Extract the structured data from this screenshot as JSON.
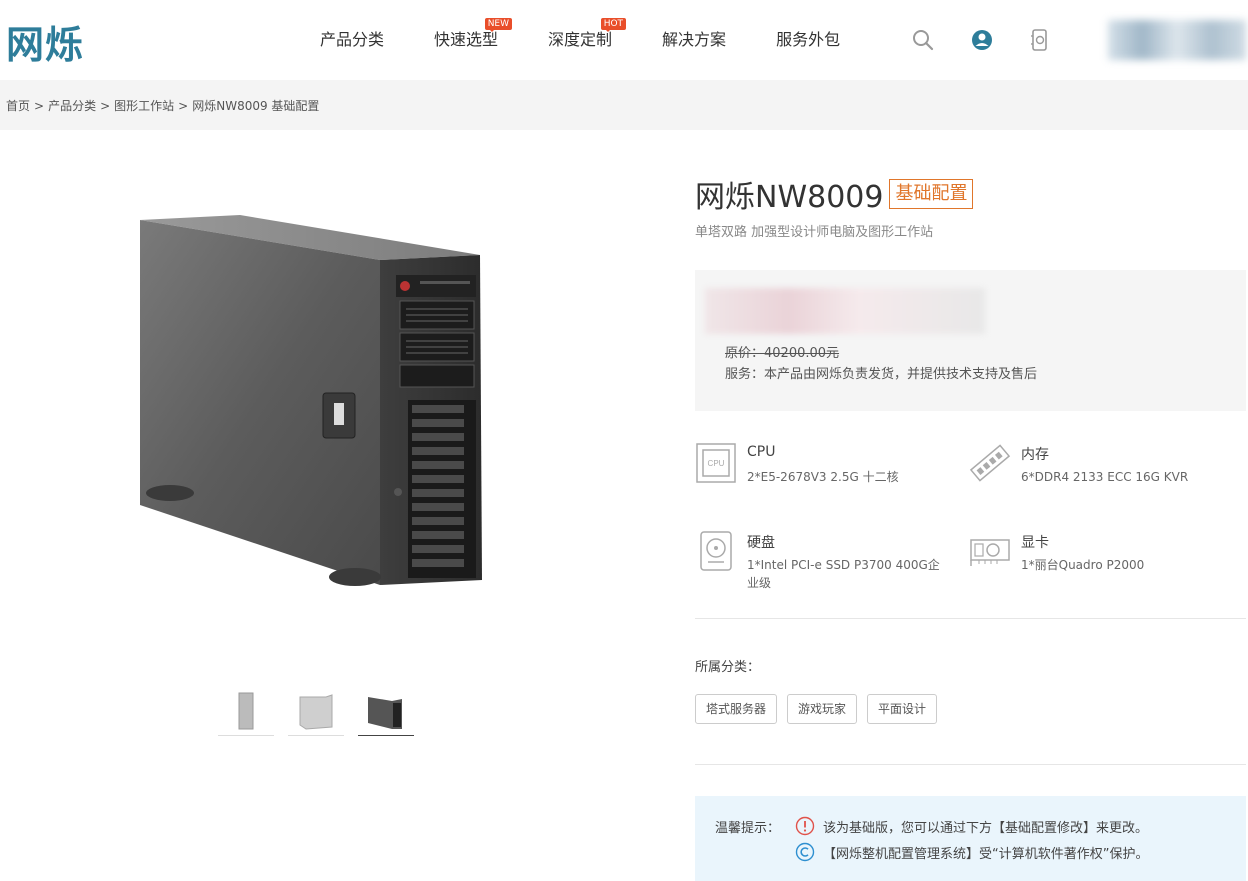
{
  "header": {
    "logo": "网烁",
    "nav": [
      {
        "label": "产品分类",
        "badge": ""
      },
      {
        "label": "快速选型",
        "badge": "NEW"
      },
      {
        "label": "深度定制",
        "badge": "HOT"
      },
      {
        "label": "解决方案",
        "badge": ""
      },
      {
        "label": "服务外包",
        "badge": ""
      }
    ],
    "icons": [
      "search-icon",
      "user-icon",
      "phone-icon"
    ]
  },
  "breadcrumb": [
    "首页",
    "产品分类",
    "图形工作站",
    "网烁NW8009 基础配置"
  ],
  "breadcrumb_sep": ">",
  "product": {
    "title": "网烁NW8009",
    "tag": "基础配置",
    "subtitle": "单塔双路 加强型设计师电脑及图形工作站",
    "original_price_label": "原价：",
    "original_price": "40200.00元",
    "service": "服务：本产品由网烁负责发货，并提供技术支持及售后"
  },
  "specs": [
    {
      "name": "CPU",
      "value": "2*E5-2678V3 2.5G 十二核",
      "icon": "cpu-icon"
    },
    {
      "name": "内存",
      "value": "6*DDR4 2133 ECC 16G KVR",
      "icon": "memory-icon"
    },
    {
      "name": "硬盘",
      "value": "1*Intel PCI-e SSD P3700 400G企业级",
      "icon": "hard-disk-icon"
    },
    {
      "name": "显卡",
      "value": "1*丽台Quadro P2000",
      "icon": "graphics-card-icon"
    }
  ],
  "category": {
    "label": "所属分类：",
    "tags": [
      "塔式服务器",
      "游戏玩家",
      "平面设计"
    ]
  },
  "tip": {
    "label": "温馨提示：",
    "line1": "该为基础版，您可以通过下方【基础配置修改】来更改。",
    "line2": "【网烁整机配置管理系统】受“计算机软件著作权”保护。"
  },
  "colors": {
    "brand": "#2e7d9a",
    "accent_orange": "#e0762b",
    "badge_red": "#e94e2a",
    "tip_bg": "#eaf5fc"
  }
}
